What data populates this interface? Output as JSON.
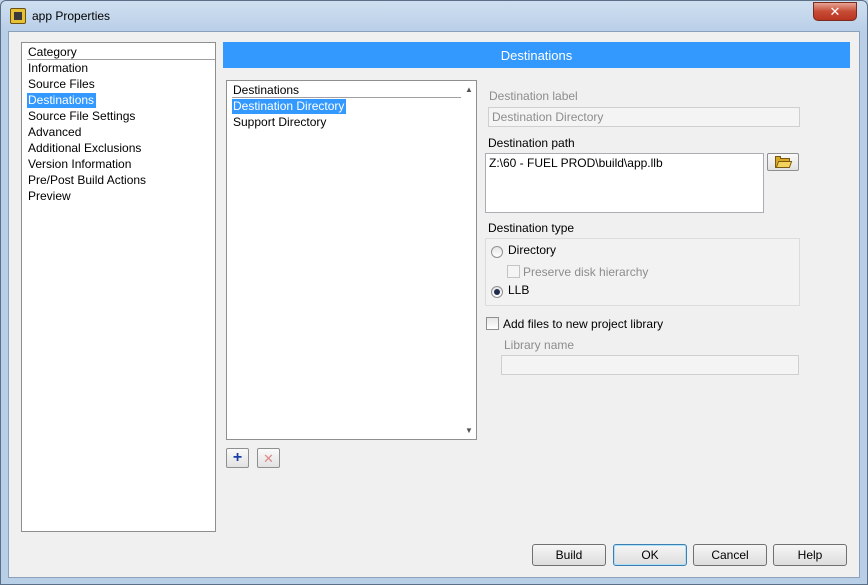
{
  "window": {
    "title": "app Properties",
    "close_label": "✕",
    "app_icon": "labview-project-icon"
  },
  "category": {
    "header": "Category",
    "items": [
      {
        "label": "Information"
      },
      {
        "label": "Source Files"
      },
      {
        "label": "Destinations",
        "selected": true
      },
      {
        "label": "Source File Settings"
      },
      {
        "label": "Advanced"
      },
      {
        "label": "Additional Exclusions"
      },
      {
        "label": "Version Information"
      },
      {
        "label": "Pre/Post Build Actions"
      },
      {
        "label": "Preview"
      }
    ]
  },
  "section": {
    "title": "Destinations"
  },
  "destinations": {
    "header": "Destinations",
    "items": [
      {
        "label": "Destination Directory",
        "selected": true
      },
      {
        "label": "Support Directory"
      }
    ],
    "add_label": "+",
    "remove_label": "✕"
  },
  "form": {
    "destination_label": {
      "label": "Destination label",
      "value": "Destination Directory"
    },
    "destination_path": {
      "label": "Destination path",
      "value": "Z:\\60 - FUEL PROD\\build\\app.llb"
    },
    "destination_type": {
      "label": "Destination type",
      "options": [
        {
          "label": "Directory",
          "selected": false
        },
        {
          "label": "LLB",
          "selected": true
        }
      ],
      "preserve_hierarchy": {
        "label": "Preserve disk hierarchy",
        "checked": false
      }
    },
    "add_to_library": {
      "label": "Add files to new project library",
      "checked": false
    },
    "library_name": {
      "label": "Library name",
      "value": ""
    }
  },
  "buttons": {
    "build": "Build",
    "ok": "OK",
    "cancel": "Cancel",
    "help": "Help"
  },
  "colors": {
    "selection": "#3399ff",
    "banner": "#3399ff"
  }
}
